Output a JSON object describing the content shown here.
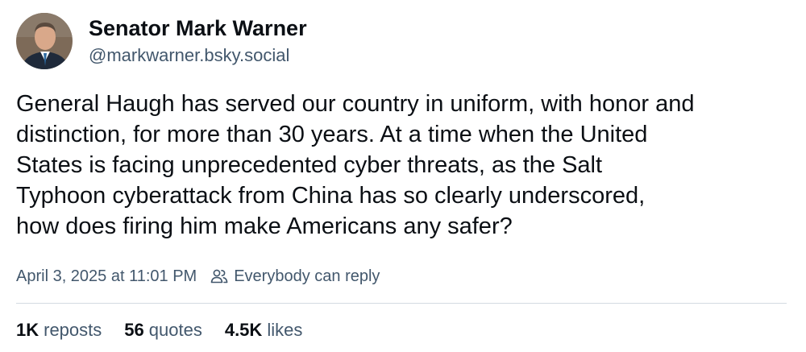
{
  "author": {
    "display_name": "Senator Mark Warner",
    "handle": "@markwarner.bsky.social"
  },
  "post": {
    "lines": [
      "General Haugh has served our country in uniform, with honor and",
      "distinction, for more than 30 years. At a time when the United",
      "States is facing unprecedented cyber threats, as the Salt",
      "Typhoon cyberattack from China has so clearly underscored,",
      "how does firing him make Americans any safer?"
    ]
  },
  "meta": {
    "timestamp": "April 3, 2025 at 11:01 PM",
    "reply_setting": "Everybody can reply",
    "reply_icon": "people-icon"
  },
  "stats": {
    "reposts": {
      "count": "1K",
      "label": "reposts"
    },
    "quotes": {
      "count": "56",
      "label": "quotes"
    },
    "likes": {
      "count": "4.5K",
      "label": "likes"
    }
  }
}
